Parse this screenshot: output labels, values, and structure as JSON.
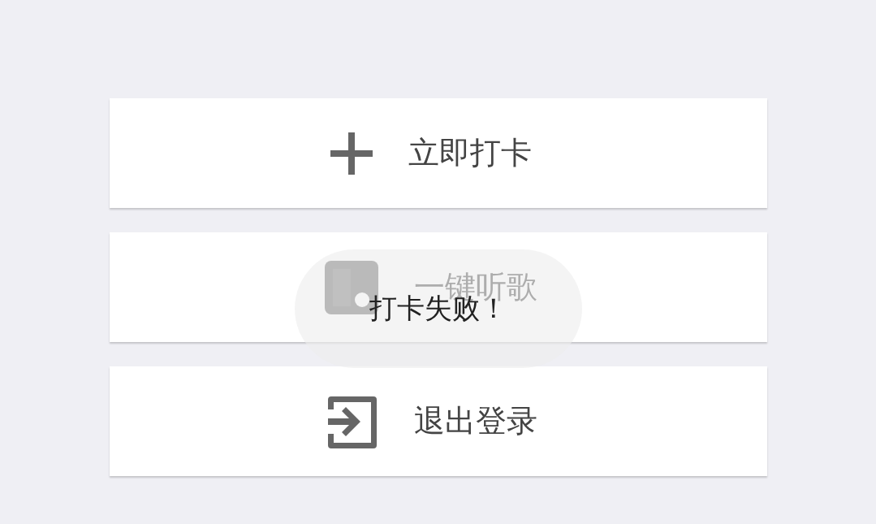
{
  "actions": [
    {
      "kind": "checkin",
      "label": "立即打卡"
    },
    {
      "kind": "music",
      "label": "一键听歌"
    },
    {
      "kind": "logout",
      "label": "退出登录"
    }
  ],
  "toast": {
    "message": "打卡失败！"
  }
}
